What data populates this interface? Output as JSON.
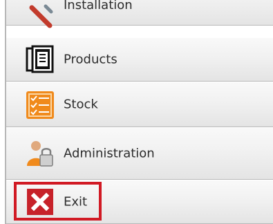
{
  "menu": {
    "items": [
      {
        "label": "Installation",
        "icon": "wrench-icon"
      },
      {
        "label": "Products",
        "icon": "book-icon"
      },
      {
        "label": "Stock",
        "icon": "checklist-icon"
      },
      {
        "label": "Administration",
        "icon": "user-lock-icon"
      },
      {
        "label": "Exit",
        "icon": "close-icon"
      }
    ],
    "highlight_color": "#d11a24",
    "exit_color": "#c7222a",
    "stock_color": "#f08a1c"
  }
}
